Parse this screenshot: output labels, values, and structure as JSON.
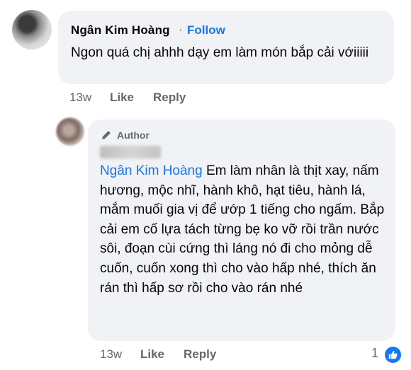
{
  "comment": {
    "author": "Ngân Kim Hoàng",
    "separator": "·",
    "follow_label": "Follow",
    "text": "Ngon quá chị ahhh dạy em làm món bắp cải vớiiiii",
    "time": "13w",
    "like_label": "Like",
    "reply_label": "Reply"
  },
  "reply": {
    "badge_label": "Author",
    "mention": "Ngân Kim Hoàng",
    "text": " Em làm nhân là thịt xay, nấm hương, mộc nhĩ, hành khô, hạt tiêu, hành lá, mắm muối gia vị để ướp 1 tiếng cho ngấm. Bắp cải em cố lựa tách từng bẹ ko vỡ rồi trần nước sôi, đoạn cùi cứng thì láng nó đi cho mỏng dễ cuốn, cuốn xong thì cho vào hấp nhé, thích ăn rán thì hấp sơ rồi cho vào rán nhé",
    "time": "13w",
    "like_label": "Like",
    "reply_label": "Reply",
    "reaction_count": "1",
    "reaction_icon": "thumbs-up-icon"
  },
  "colors": {
    "link_blue": "#1b74e4",
    "bubble_bg": "#f0f2f5",
    "secondary_text": "#65676b",
    "like_badge": "#1877f2"
  }
}
